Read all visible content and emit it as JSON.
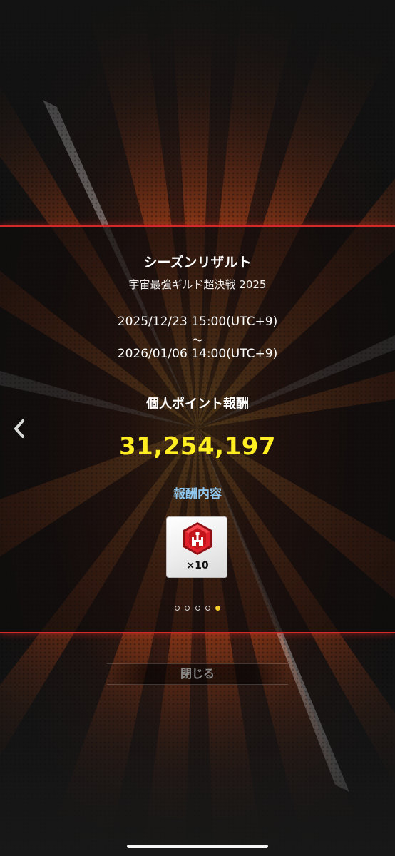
{
  "result": {
    "title": "シーズンリザルト",
    "event_name": "宇宙最強ギルド超決戦 2025",
    "period_start": "2025/12/23 15:00(UTC+9)",
    "period_separator": "～",
    "period_end": "2026/01/06 14:00(UTC+9)",
    "section_label": "個人ポイント報酬",
    "points": "31,254,197",
    "reward_label": "報酬内容",
    "reward": {
      "icon": "red-castle-gem-icon",
      "quantity": "×10"
    },
    "pager": {
      "total": 5,
      "current": 5
    }
  },
  "navigation": {
    "prev_icon": "chevron-left-icon",
    "close_label": "閉じる"
  },
  "colors": {
    "accent_border": "#d22a2a",
    "points_yellow": "#ffee22",
    "reward_label_blue": "#8fc7ee",
    "pager_active": "#f6cc2a"
  }
}
